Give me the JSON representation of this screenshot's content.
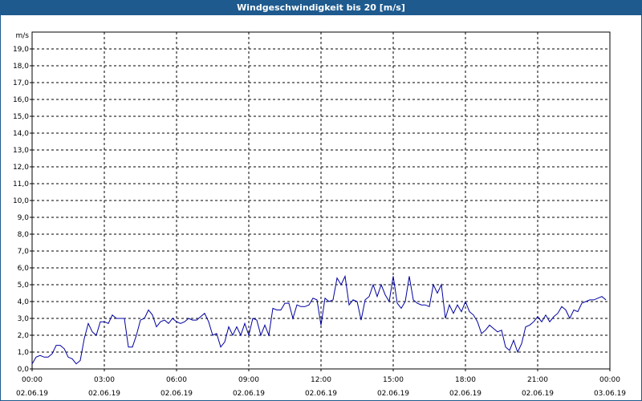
{
  "window": {
    "title": "Windgeschwindigkeit bis 20 [m/s]"
  },
  "chart_data": {
    "type": "line",
    "title": "Windgeschwindigkeit bis 20 [m/s]",
    "ylabel": "m/s",
    "xlabel": "",
    "ylim": [
      0,
      20
    ],
    "yticks": [
      "0,0",
      "1,0",
      "2,0",
      "3,0",
      "4,0",
      "5,0",
      "6,0",
      "7,0",
      "8,0",
      "9,0",
      "10,0",
      "11,0",
      "12,0",
      "13,0",
      "14,0",
      "15,0",
      "16,0",
      "17,0",
      "18,0",
      "19,0"
    ],
    "xlim": [
      "02.06.19 00:00",
      "03.06.19 00:00"
    ],
    "xticks": [
      {
        "time": "00:00",
        "date": "02.06.19"
      },
      {
        "time": "03:00",
        "date": "02.06.19"
      },
      {
        "time": "06:00",
        "date": "02.06.19"
      },
      {
        "time": "09:00",
        "date": "02.06.19"
      },
      {
        "time": "12:00",
        "date": "02.06.19"
      },
      {
        "time": "15:00",
        "date": "02.06.19"
      },
      {
        "time": "18:00",
        "date": "02.06.19"
      },
      {
        "time": "21:00",
        "date": "02.06.19"
      },
      {
        "time": "00:00",
        "date": "03.06.19"
      }
    ],
    "grid": true,
    "line_color": "#0000a0",
    "series": [
      {
        "x": [
          "00:00",
          "00:10",
          "00:20",
          "00:30",
          "00:40",
          "00:50",
          "01:00",
          "01:10",
          "01:20",
          "01:30",
          "01:40",
          "01:50",
          "02:00",
          "02:10",
          "02:20",
          "02:30",
          "02:40",
          "02:50",
          "03:00",
          "03:10",
          "03:20",
          "03:30",
          "03:40",
          "03:50",
          "04:00",
          "04:10",
          "04:20",
          "04:30",
          "04:40",
          "04:50",
          "05:00",
          "05:10",
          "05:20",
          "05:30",
          "05:40",
          "05:50",
          "06:00",
          "06:10",
          "06:20",
          "06:30",
          "06:40",
          "06:50",
          "07:00",
          "07:10",
          "07:20",
          "07:30",
          "07:40",
          "07:50",
          "08:00",
          "08:10",
          "08:20",
          "08:30",
          "08:40",
          "08:50",
          "09:00",
          "09:10",
          "09:20",
          "09:30",
          "09:40",
          "09:50",
          "10:00",
          "10:10",
          "10:20",
          "10:30",
          "10:40",
          "10:50",
          "11:00",
          "11:10",
          "11:20",
          "11:30",
          "11:40",
          "11:50",
          "12:00",
          "12:10",
          "12:20",
          "12:30",
          "12:40",
          "12:50",
          "13:00",
          "13:10",
          "13:20",
          "13:30",
          "13:40",
          "13:50",
          "14:00",
          "14:10",
          "14:20",
          "14:30",
          "14:40",
          "14:50",
          "15:00",
          "15:10",
          "15:20",
          "15:30",
          "15:40",
          "15:50",
          "16:00",
          "16:10",
          "16:20",
          "16:30",
          "16:40",
          "16:50",
          "17:00",
          "17:10",
          "17:20",
          "17:30",
          "17:40",
          "17:50",
          "18:00",
          "18:10",
          "18:20",
          "18:30",
          "18:40",
          "18:50",
          "19:00",
          "19:10",
          "19:20",
          "19:30",
          "19:40",
          "19:50",
          "20:00",
          "20:10",
          "20:20",
          "20:30",
          "20:40",
          "20:50",
          "21:00",
          "21:10",
          "21:20",
          "21:30",
          "21:40",
          "21:50",
          "22:00",
          "22:10",
          "22:20",
          "22:30",
          "22:40",
          "22:50",
          "23:00",
          "23:10",
          "23:20",
          "23:30",
          "23:40",
          "23:50"
        ],
        "values": [
          0.3,
          0.7,
          0.8,
          0.7,
          0.7,
          0.9,
          1.4,
          1.4,
          1.2,
          0.7,
          0.6,
          0.3,
          0.5,
          1.8,
          2.7,
          2.2,
          2.0,
          2.8,
          2.8,
          2.7,
          3.2,
          3.0,
          3.0,
          3.0,
          1.3,
          1.3,
          2.0,
          2.9,
          3.0,
          3.5,
          3.2,
          2.5,
          2.8,
          2.9,
          2.7,
          3.0,
          2.8,
          2.7,
          2.8,
          3.0,
          2.9,
          2.9,
          3.1,
          3.3,
          2.8,
          2.0,
          2.1,
          1.3,
          1.6,
          2.5,
          2.0,
          2.5,
          2.0,
          2.7,
          2.0,
          3.0,
          2.9,
          2.0,
          2.6,
          2.0,
          3.6,
          3.5,
          3.5,
          3.9,
          3.9,
          3.0,
          3.8,
          3.7,
          3.7,
          3.8,
          4.2,
          4.1,
          2.6,
          4.2,
          4.0,
          4.1,
          5.4,
          5.0,
          5.5,
          3.8,
          4.1,
          4.0,
          2.9,
          4.1,
          4.3,
          5.0,
          4.3,
          5.0,
          4.4,
          4.0,
          5.5,
          3.9,
          3.6,
          4.0,
          5.5,
          4.1,
          3.9,
          3.8,
          3.8,
          3.7,
          5.0,
          4.5,
          5.0,
          3.0,
          3.8,
          3.3,
          3.8,
          3.4,
          4.0,
          3.4,
          3.2,
          2.8,
          2.1,
          2.3,
          2.6,
          2.4,
          2.2,
          2.3,
          1.3,
          1.1,
          1.7,
          1.0,
          1.5,
          2.5,
          2.6,
          2.8,
          3.1,
          2.8,
          3.2,
          2.8,
          3.1,
          3.3,
          3.7,
          3.5,
          3.0,
          3.5,
          3.4,
          3.9,
          4.0,
          4.1,
          4.1,
          4.2,
          4.3,
          4.1
        ]
      }
    ]
  }
}
